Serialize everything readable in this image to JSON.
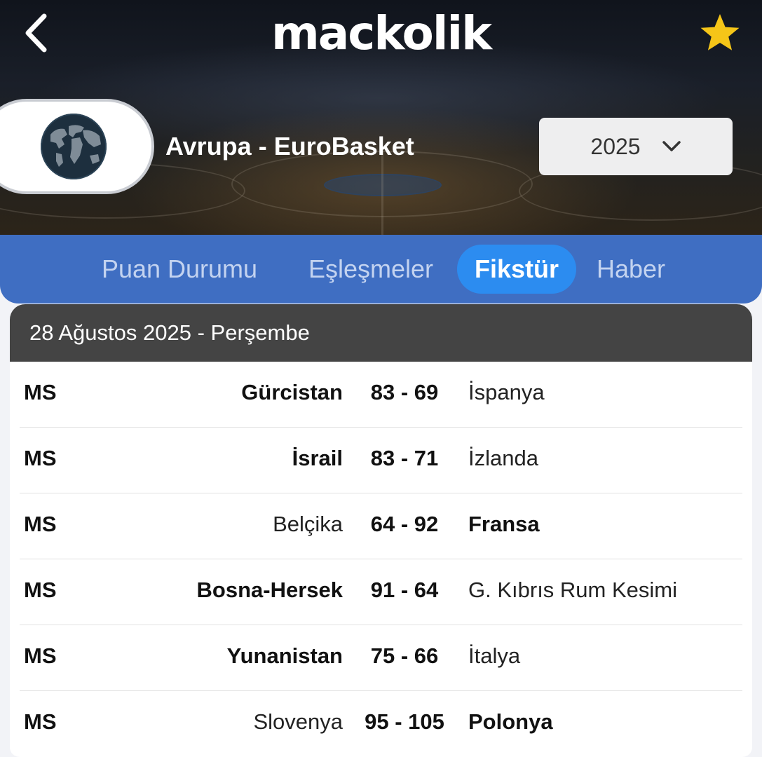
{
  "header": {
    "brand": "mackolik",
    "league_name": "Avrupa - EuroBasket",
    "season": "2025",
    "icons": {
      "back": "chevron-left-icon",
      "favorite": "star-icon",
      "dropdown": "chevron-down-icon",
      "league_logo": "globe-icon"
    },
    "colors": {
      "star": "#f5c518",
      "tabs_bg": "#3f6ec2",
      "tab_active": "#2c8cf0"
    }
  },
  "tabs": [
    {
      "label": "Puan Durumu",
      "active": false
    },
    {
      "label": "Eşleşmeler",
      "active": false
    },
    {
      "label": "Fikstür",
      "active": true
    },
    {
      "label": "Haber",
      "active": false
    }
  ],
  "fixtures": {
    "date_header": "28 Ağustos 2025 - Perşembe",
    "matches": [
      {
        "status": "MS",
        "home": "Gürcistan",
        "score": "83 - 69",
        "away": "İspanya",
        "winner": "home"
      },
      {
        "status": "MS",
        "home": "İsrail",
        "score": "83 - 71",
        "away": "İzlanda",
        "winner": "home"
      },
      {
        "status": "MS",
        "home": "Belçika",
        "score": "64 - 92",
        "away": "Fransa",
        "winner": "away"
      },
      {
        "status": "MS",
        "home": "Bosna-Hersek",
        "score": "91 - 64",
        "away": "G. Kıbrıs Rum Kesimi",
        "winner": "home"
      },
      {
        "status": "MS",
        "home": "Yunanistan",
        "score": "75 - 66",
        "away": "İtalya",
        "winner": "home"
      },
      {
        "status": "MS",
        "home": "Slovenya",
        "score": "95 - 105",
        "away": "Polonya",
        "winner": "away"
      }
    ]
  }
}
